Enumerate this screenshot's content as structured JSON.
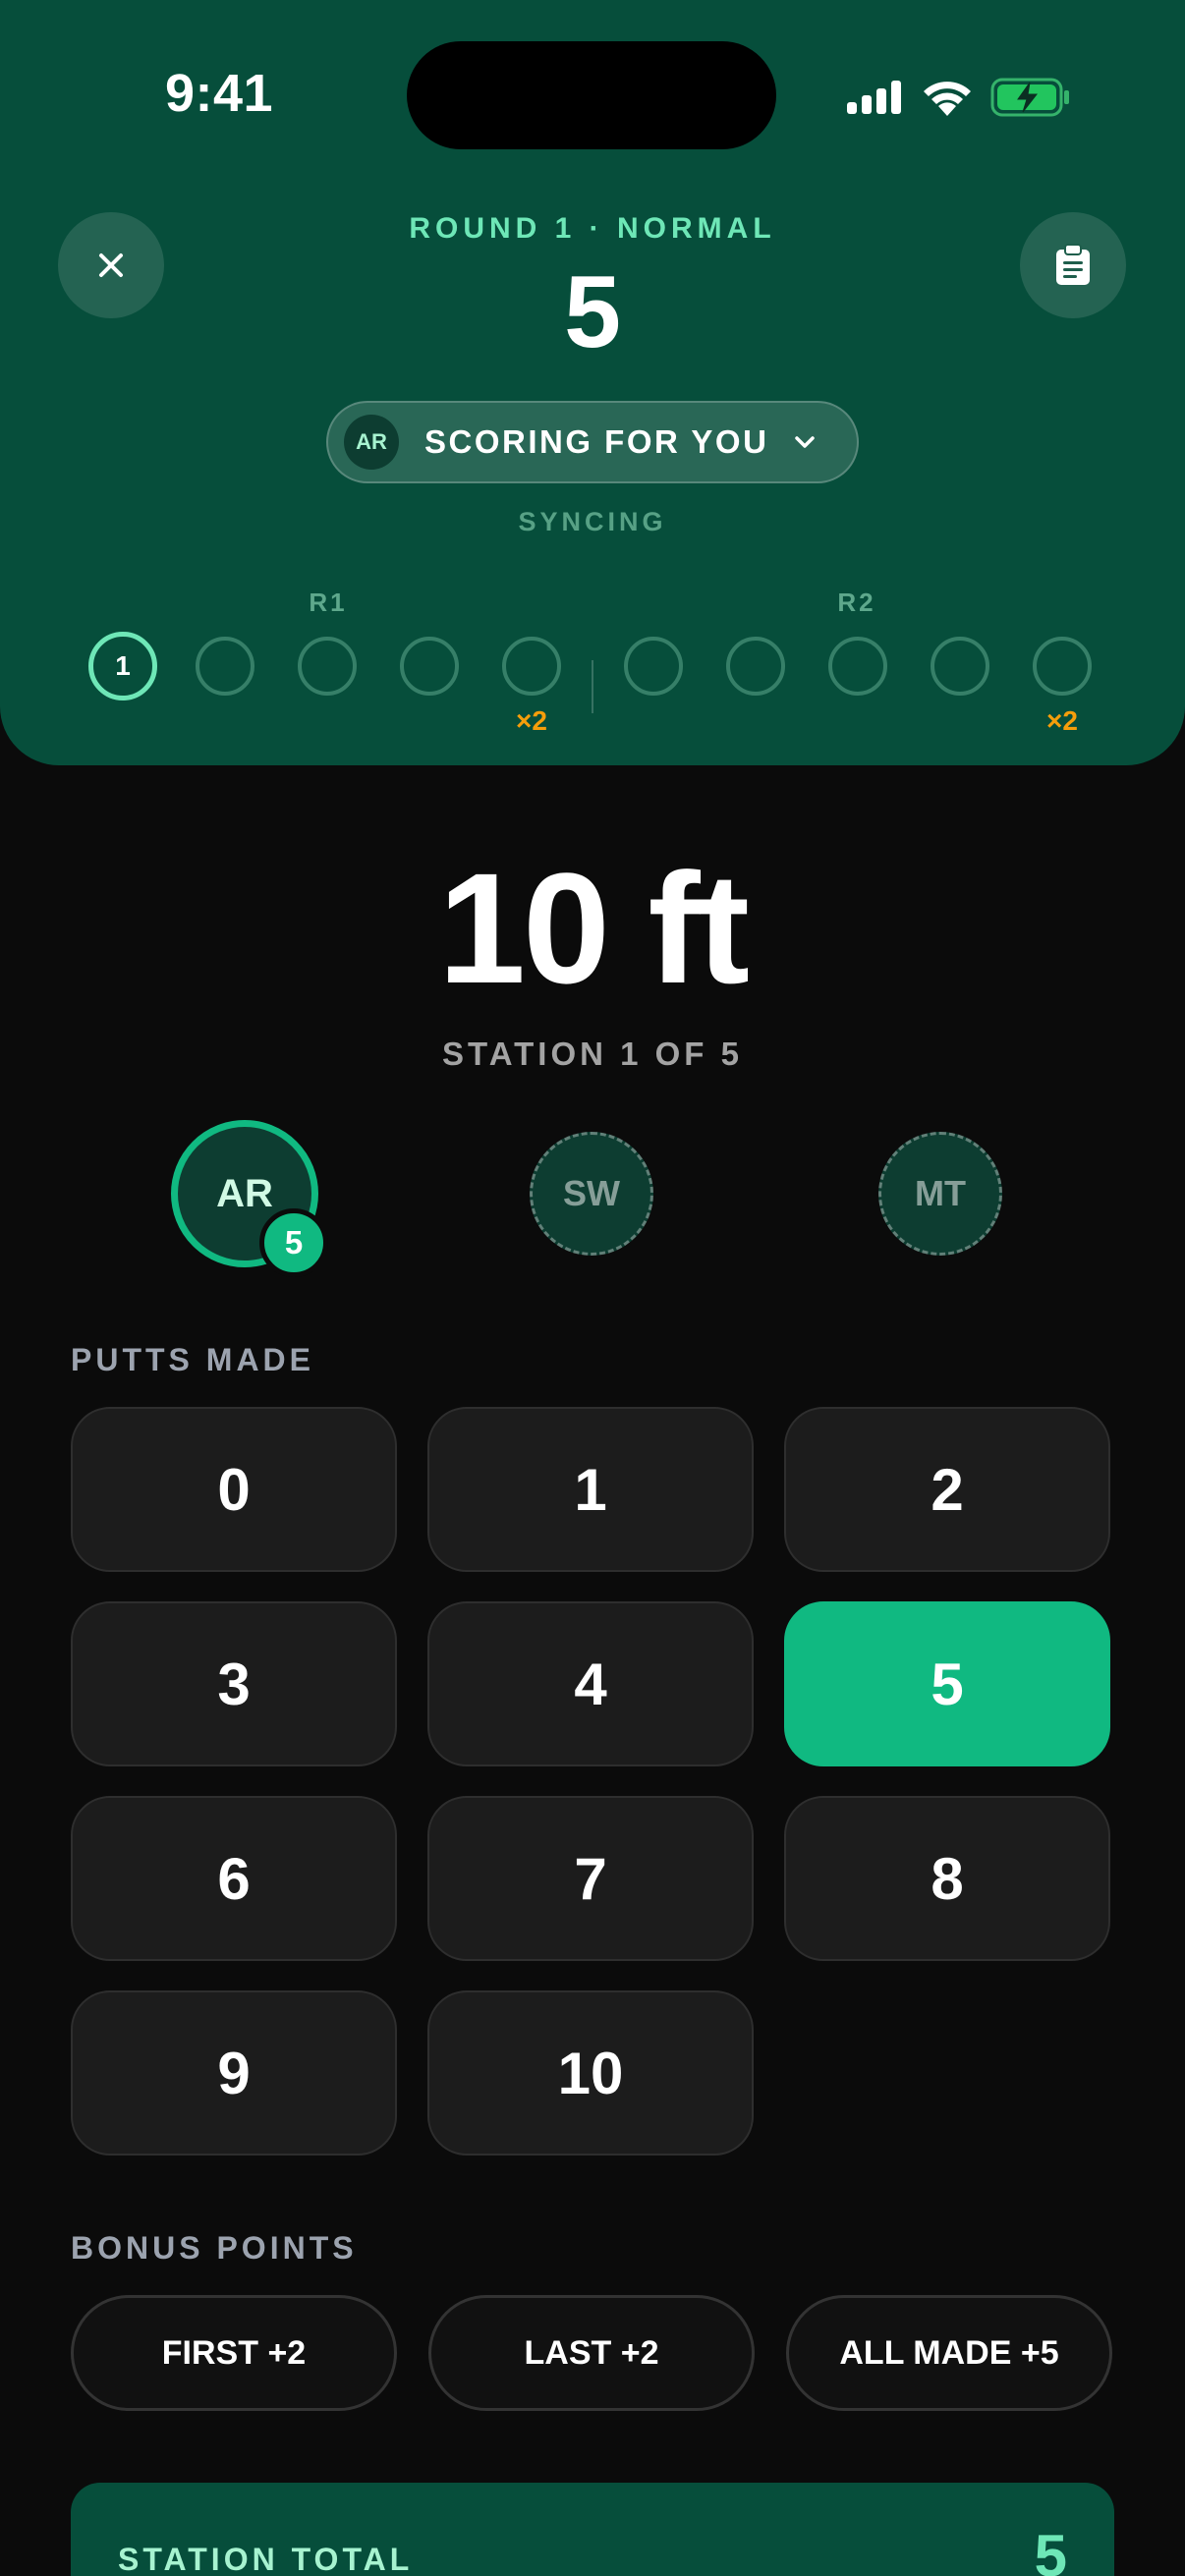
{
  "status": {
    "time": "9:41"
  },
  "header": {
    "round_label": "ROUND 1 · NORMAL",
    "score": "5",
    "scoring_pill": {
      "initials": "AR",
      "label": "SCORING FOR YOU"
    },
    "sync_status": "SYNCING",
    "groups": [
      {
        "label": "R1"
      },
      {
        "label": "R2"
      }
    ],
    "stations": [
      {
        "label": "1",
        "active": true
      },
      {
        "label": ""
      },
      {
        "label": ""
      },
      {
        "label": ""
      },
      {
        "label": "",
        "multiplier": "×2"
      },
      {
        "label": ""
      },
      {
        "label": ""
      },
      {
        "label": ""
      },
      {
        "label": ""
      },
      {
        "label": "",
        "multiplier": "×2"
      }
    ]
  },
  "station": {
    "distance": "10 ft",
    "label": "STATION 1 OF 5"
  },
  "players": [
    {
      "initials": "AR",
      "score": "5",
      "current": true
    },
    {
      "initials": "SW"
    },
    {
      "initials": "MT"
    }
  ],
  "putts": {
    "label": "PUTTS MADE",
    "options": [
      "0",
      "1",
      "2",
      "3",
      "4",
      "5",
      "6",
      "7",
      "8",
      "9",
      "10"
    ],
    "selected": "5"
  },
  "bonus": {
    "label": "BONUS POINTS",
    "options": [
      "FIRST +2",
      "LAST +2",
      "ALL MADE +5"
    ]
  },
  "total": {
    "label": "STATION TOTAL",
    "value": "5"
  },
  "colors": {
    "header_bg": "#064e3b",
    "accent": "#10b981",
    "accent_light": "#6ee7b7",
    "multiplier": "#f59e0b",
    "page_bg": "#0b0b0b"
  }
}
